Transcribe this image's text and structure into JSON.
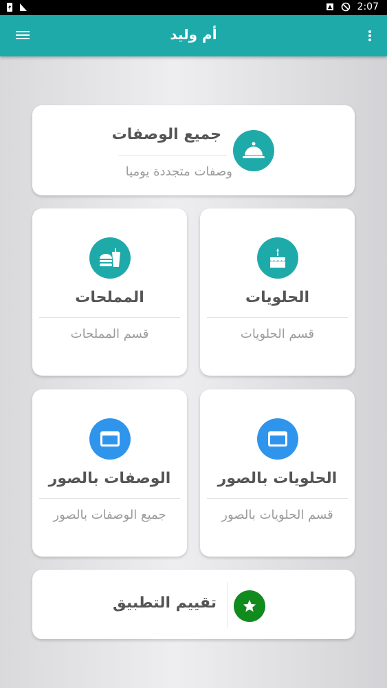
{
  "status_bar": {
    "time": "2:07"
  },
  "app_bar": {
    "title": "أم وليد",
    "menu_icon": "hamburger-menu-icon",
    "overflow_icon": "more-vert-icon",
    "color": "#1faaaa"
  },
  "all_recipes": {
    "title": "جميع الوصفات",
    "subtitle": "وصفات متجددة يوميا",
    "icon": "cloche-icon"
  },
  "tiles": [
    {
      "title": "الحلويات",
      "subtitle": "قسم الحلويات",
      "icon": "birthday-cake-icon"
    },
    {
      "title": "المملحات",
      "subtitle": "قسم المملحات",
      "icon": "fastfood-icon"
    },
    {
      "title": "الحلويات بالصور",
      "subtitle": "قسم الحلويات بالصور",
      "icon": "window-icon"
    },
    {
      "title": "الوصفات بالصور",
      "subtitle": "جميع الوصفات بالصور",
      "icon": "window-icon"
    }
  ],
  "rate": {
    "title": "تقييم التطبيق",
    "icon": "star-icon"
  },
  "colors": {
    "teal": "#1faaaa",
    "blue": "#2f95ec",
    "green": "#118a1e"
  }
}
